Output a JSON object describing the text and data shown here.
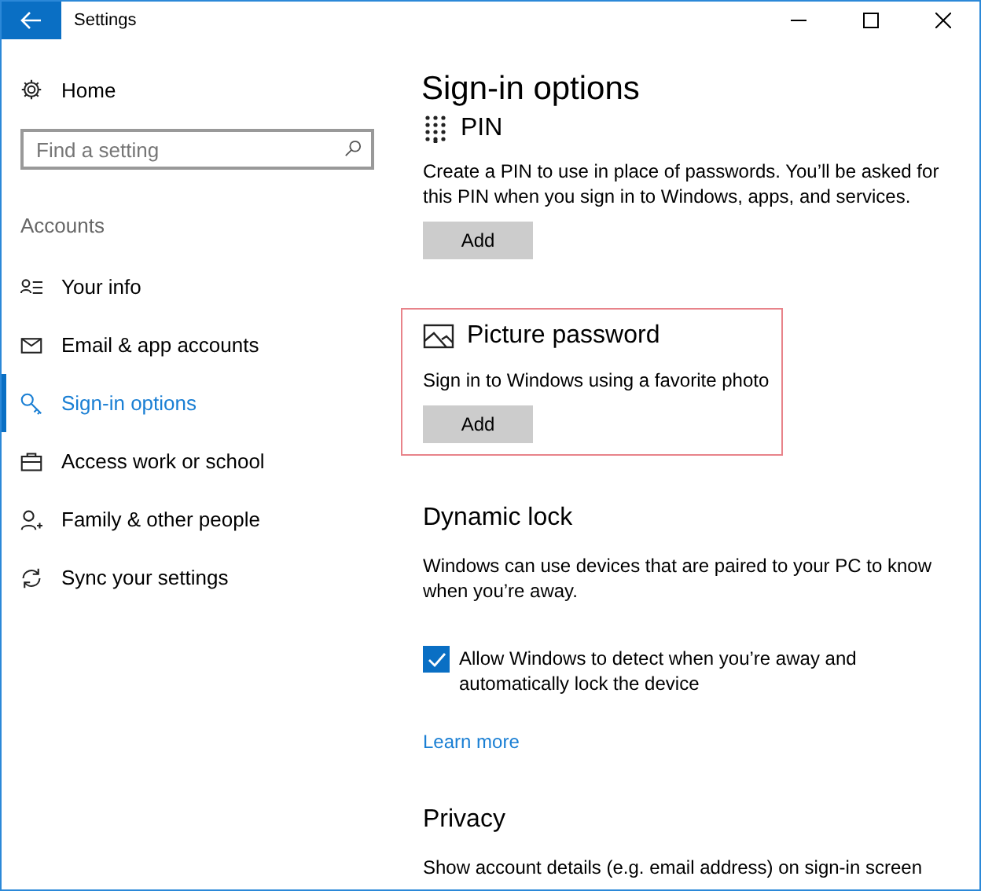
{
  "window": {
    "title": "Settings"
  },
  "sidebar": {
    "home": "Home",
    "search": {
      "placeholder": "Find a setting"
    },
    "group": "Accounts",
    "items": [
      {
        "label": "Your info",
        "selected": false
      },
      {
        "label": "Email & app accounts",
        "selected": false
      },
      {
        "label": "Sign-in options",
        "selected": true
      },
      {
        "label": "Access work or school",
        "selected": false
      },
      {
        "label": "Family & other people",
        "selected": false
      },
      {
        "label": "Sync your settings",
        "selected": false
      }
    ]
  },
  "page_title": "Sign-in options",
  "sections": [
    {
      "title": "PIN",
      "text": "Create a PIN to use in place of passwords. You’ll be asked for this PIN when you sign in to Windows, apps, and services.",
      "button": "Add",
      "highlighted": false
    },
    {
      "title": "Picture password",
      "text": "Sign in to Windows using a favorite photo",
      "button": "Add",
      "highlighted": true
    },
    {
      "title": "Dynamic lock",
      "text": "Windows can use devices that are paired to your PC to know when you’re away.",
      "checkbox": {
        "label": "Allow Windows to detect when you’re away and automatically lock the device",
        "checked": true
      },
      "link": "Learn more",
      "highlighted": false
    },
    {
      "title": "Privacy",
      "text": "Show account details (e.g. email address) on sign-in screen",
      "highlighted": false
    }
  ]
}
